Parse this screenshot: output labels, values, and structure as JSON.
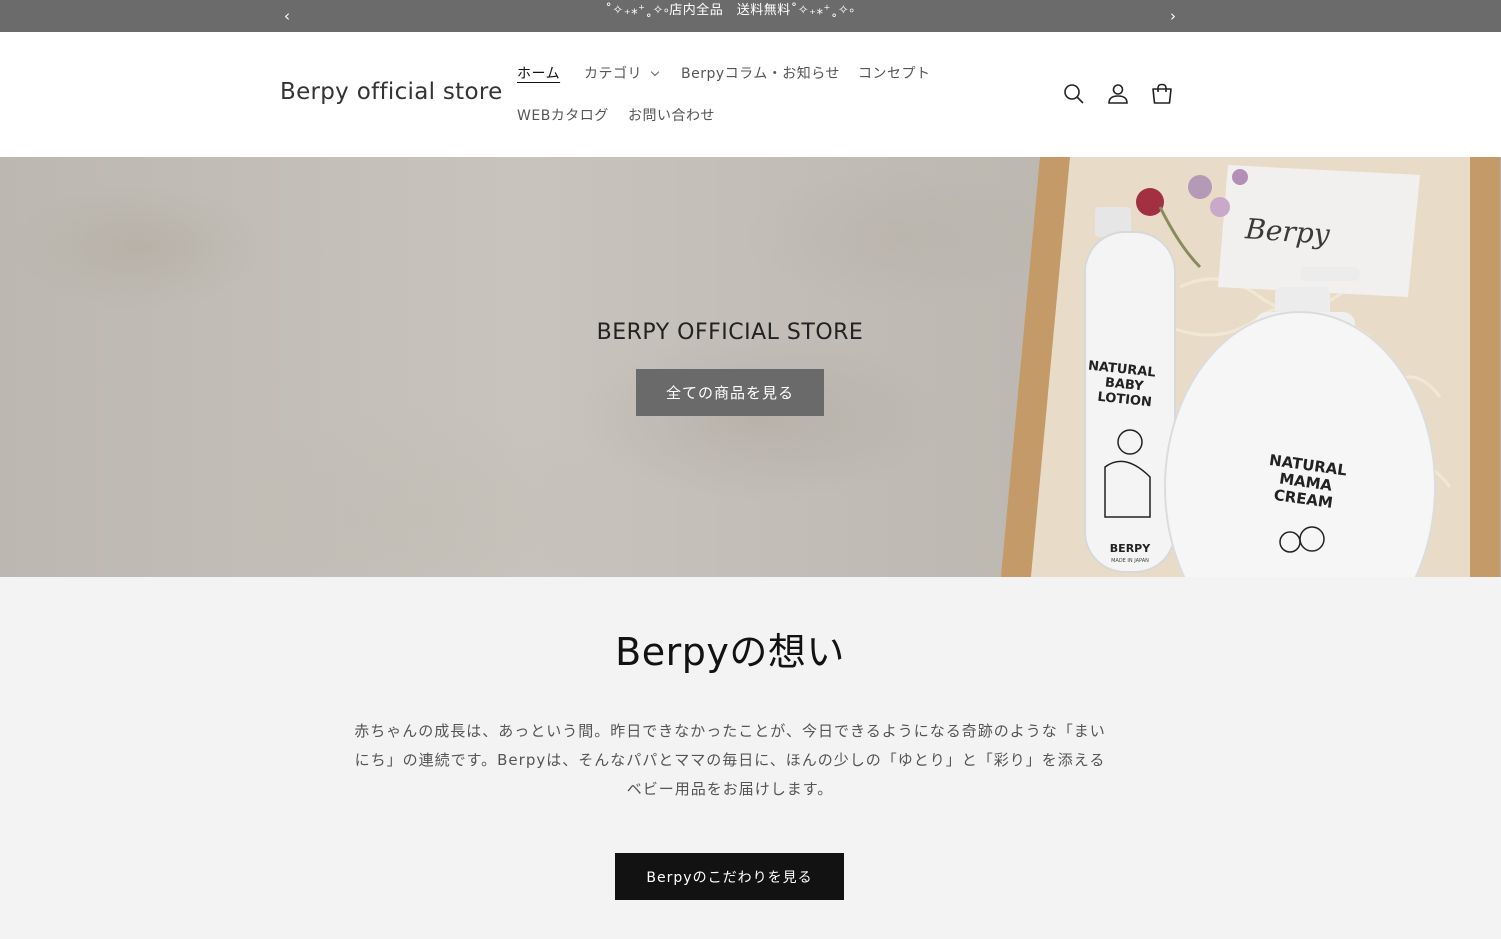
{
  "announcement": {
    "text": "˚✧₊⁎⁺˳✧༚店内全品　送料無料˚✧₊⁎⁺˳✧༚"
  },
  "header": {
    "logo": "Berpy official store",
    "nav": [
      {
        "label": "ホーム",
        "active": true
      },
      {
        "label": "カテゴリ",
        "has_dropdown": true
      },
      {
        "label": "Berpyコラム・お知らせ"
      },
      {
        "label": "コンセプト"
      },
      {
        "label": "WEBカタログ"
      },
      {
        "label": "お問い合わせ"
      }
    ],
    "icons": [
      "search-icon",
      "account-icon",
      "cart-icon"
    ]
  },
  "hero": {
    "title": "BERPY OFFICIAL STORE",
    "button": "全ての商品を見る",
    "image_text": {
      "card": "Berpy",
      "bottle_left": [
        "NATURAL",
        "BABY",
        "LOTION"
      ],
      "bottle_left_brand": "BERPY",
      "bottle_left_sub": "MADE IN JAPAN",
      "bottle_right": [
        "NATURAL",
        "MAMA",
        "CREAM"
      ]
    }
  },
  "section": {
    "title": "Berpyの想い",
    "text_lines": [
      "赤ちゃんの成長は、あっという間。昨日できなかったことが、今日できるようになる奇跡のような「まい",
      "にち」の連続です。Berpyは、そんなパパとママの毎日に、ほんの少しの「ゆとり」と「彩り」を添える",
      "ベビー用品をお届けします。"
    ],
    "button": "Berpyのこだわりを見る"
  },
  "colors": {
    "announcement_bg": "#6b6b6b",
    "hero_button_bg": "#6a6a6a",
    "section_button_bg": "#121212",
    "section_bg": "#f3f3f3"
  }
}
